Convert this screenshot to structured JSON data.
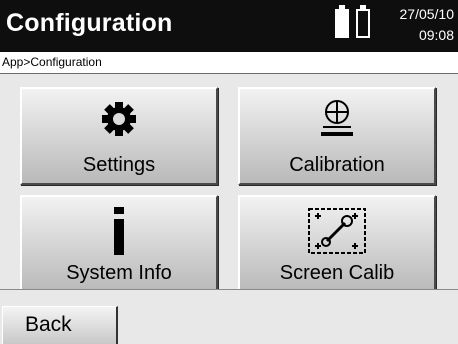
{
  "header": {
    "title": "Configuration",
    "date": "27/05/10",
    "time": "09:08",
    "battery_icons": [
      "battery-full-icon",
      "battery-empty-icon"
    ]
  },
  "breadcrumb": "App>Configuration",
  "tiles": [
    {
      "label": "Settings",
      "icon": "gear-icon"
    },
    {
      "label": "Calibration",
      "icon": "level-crosshair-icon"
    },
    {
      "label": "System Info",
      "icon": "info-icon"
    },
    {
      "label": "Screen Calib",
      "icon": "screen-calibration-icon"
    }
  ],
  "footer": {
    "back_label": "Back"
  },
  "colors": {
    "titlebar": "#0e0e0e",
    "panel": "#e8e8e8"
  }
}
